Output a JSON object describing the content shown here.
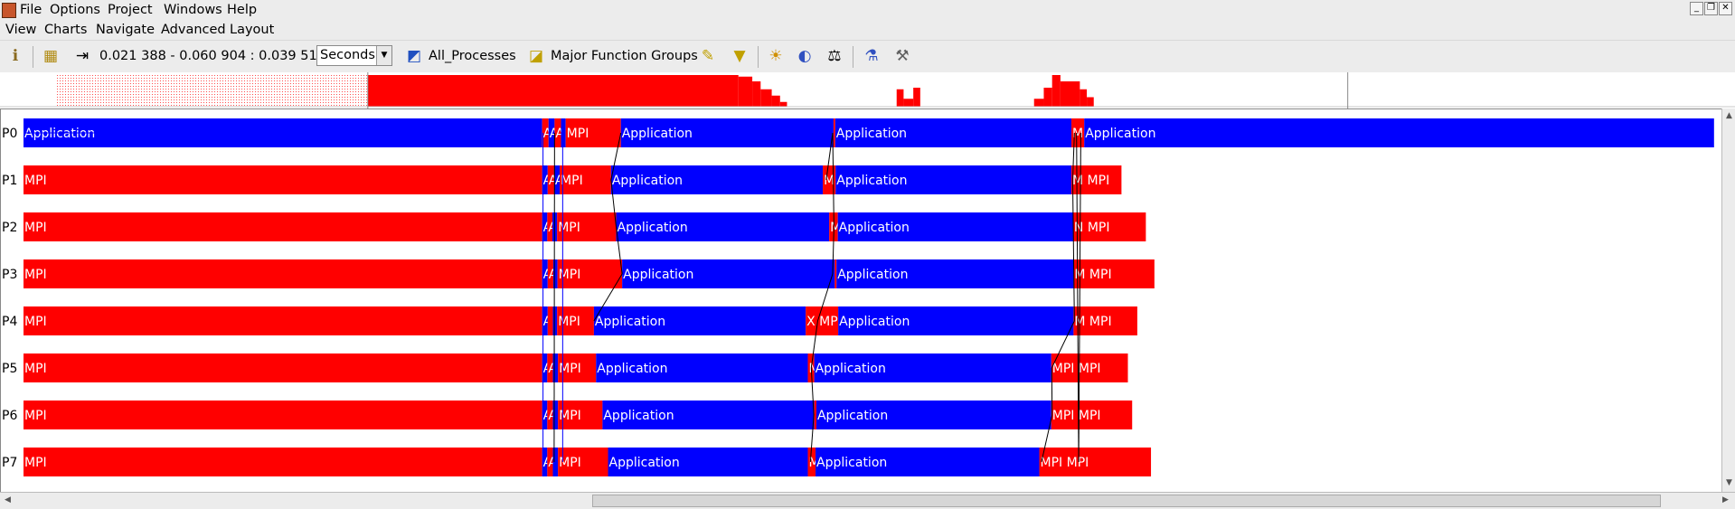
{
  "menubar": {
    "items": [
      "File",
      "Options",
      "Project",
      "Windows",
      "Help"
    ]
  },
  "submenu": {
    "items": [
      "View",
      "Charts",
      "Navigate",
      "Advanced",
      "Layout"
    ]
  },
  "window_controls": [
    "minimize",
    "restore",
    "close"
  ],
  "toolbar": {
    "time_range": "0.021 388 - 0.060 904 : 0.039 516",
    "unit": "Seconds",
    "process_filter": "All_Processes",
    "function_group": "Major Function Groups",
    "icons": [
      "info-icon",
      "timeline-icon",
      "zoom-range-icon",
      "process-filter-icon",
      "function-group-icon",
      "highlight-icon",
      "filter-icon",
      "sun-icon",
      "contrast-icon",
      "balance-icon",
      "wand-icon",
      "tools-icon"
    ]
  },
  "colors": {
    "mpi": "#ff0000",
    "application": "#0000ff",
    "message_line": "#000000"
  },
  "legend_labels": {
    "mpi": "MPI",
    "application": "Application"
  },
  "processes": [
    {
      "label": "P0",
      "segments": [
        {
          "s": 0.021388,
          "e": 0.03351,
          "t": "application",
          "txt": "Application"
        },
        {
          "s": 0.03351,
          "e": 0.03366,
          "t": "mpi",
          "txt": "A"
        },
        {
          "s": 0.03366,
          "e": 0.0338,
          "t": "application",
          "txt": "A"
        },
        {
          "s": 0.0338,
          "e": 0.03395,
          "t": "mpi",
          "txt": "A"
        },
        {
          "s": 0.03395,
          "e": 0.03406,
          "t": "application",
          "txt": ""
        },
        {
          "s": 0.03406,
          "e": 0.03535,
          "t": "mpi",
          "txt": "MPI"
        },
        {
          "s": 0.03535,
          "e": 0.04032,
          "t": "application",
          "txt": "Application"
        },
        {
          "s": 0.04032,
          "e": 0.04036,
          "t": "mpi",
          "txt": ""
        },
        {
          "s": 0.04036,
          "e": 0.04588,
          "t": "application",
          "txt": "Application"
        },
        {
          "s": 0.04588,
          "e": 0.04618,
          "t": "mpi",
          "txt": "MI"
        },
        {
          "s": 0.04618,
          "e": 0.0609,
          "t": "application",
          "txt": "Application"
        }
      ]
    },
    {
      "label": "P1",
      "segments": [
        {
          "s": 0.021388,
          "e": 0.03351,
          "t": "mpi",
          "txt": "MPI"
        },
        {
          "s": 0.03351,
          "e": 0.03364,
          "t": "application",
          "txt": "A"
        },
        {
          "s": 0.03364,
          "e": 0.03379,
          "t": "mpi",
          "txt": "A"
        },
        {
          "s": 0.03379,
          "e": 0.03392,
          "t": "application",
          "txt": "A"
        },
        {
          "s": 0.03392,
          "e": 0.03512,
          "t": "mpi",
          "txt": "MPI"
        },
        {
          "s": 0.03512,
          "e": 0.04007,
          "t": "application",
          "txt": "Application"
        },
        {
          "s": 0.04007,
          "e": 0.04037,
          "t": "mpi",
          "txt": "M"
        },
        {
          "s": 0.04037,
          "e": 0.04588,
          "t": "application",
          "txt": "Application"
        },
        {
          "s": 0.04588,
          "e": 0.04705,
          "t": "mpi",
          "txt": "M MPI"
        }
      ]
    },
    {
      "label": "P2",
      "segments": [
        {
          "s": 0.021388,
          "e": 0.03351,
          "t": "mpi",
          "txt": "MPI"
        },
        {
          "s": 0.03351,
          "e": 0.03363,
          "t": "application",
          "txt": "A"
        },
        {
          "s": 0.03363,
          "e": 0.03375,
          "t": "mpi",
          "txt": "A"
        },
        {
          "s": 0.03375,
          "e": 0.03386,
          "t": "application",
          "txt": ""
        },
        {
          "s": 0.03386,
          "e": 0.03524,
          "t": "mpi",
          "txt": "MPI"
        },
        {
          "s": 0.03524,
          "e": 0.04022,
          "t": "application",
          "txt": "Application"
        },
        {
          "s": 0.04022,
          "e": 0.04042,
          "t": "mpi",
          "txt": "M"
        },
        {
          "s": 0.04042,
          "e": 0.04592,
          "t": "application",
          "txt": "Application"
        },
        {
          "s": 0.04592,
          "e": 0.04762,
          "t": "mpi",
          "txt": "N MPI"
        }
      ]
    },
    {
      "label": "P3",
      "segments": [
        {
          "s": 0.021388,
          "e": 0.03351,
          "t": "mpi",
          "txt": "MPI"
        },
        {
          "s": 0.03351,
          "e": 0.03364,
          "t": "application",
          "txt": "A"
        },
        {
          "s": 0.03364,
          "e": 0.03377,
          "t": "mpi",
          "txt": "A"
        },
        {
          "s": 0.03377,
          "e": 0.03387,
          "t": "application",
          "txt": ""
        },
        {
          "s": 0.03387,
          "e": 0.03538,
          "t": "mpi",
          "txt": "MPI"
        },
        {
          "s": 0.03538,
          "e": 0.04035,
          "t": "application",
          "txt": "Application"
        },
        {
          "s": 0.04035,
          "e": 0.04039,
          "t": "mpi",
          "txt": ""
        },
        {
          "s": 0.04039,
          "e": 0.04593,
          "t": "application",
          "txt": "Application"
        },
        {
          "s": 0.04593,
          "e": 0.04782,
          "t": "mpi",
          "txt": "M MPI"
        }
      ]
    },
    {
      "label": "P4",
      "segments": [
        {
          "s": 0.021388,
          "e": 0.03351,
          "t": "mpi",
          "txt": "MPI"
        },
        {
          "s": 0.03351,
          "e": 0.03364,
          "t": "application",
          "txt": "A"
        },
        {
          "s": 0.03364,
          "e": 0.03376,
          "t": "mpi",
          "txt": ""
        },
        {
          "s": 0.03376,
          "e": 0.03386,
          "t": "application",
          "txt": ""
        },
        {
          "s": 0.03386,
          "e": 0.03472,
          "t": "mpi",
          "txt": "MPI"
        },
        {
          "s": 0.03472,
          "e": 0.03967,
          "t": "application",
          "txt": "Application"
        },
        {
          "s": 0.03967,
          "e": 0.04043,
          "t": "mpi",
          "txt": "X MPI"
        },
        {
          "s": 0.04043,
          "e": 0.04593,
          "t": "application",
          "txt": "Application"
        },
        {
          "s": 0.04593,
          "e": 0.04742,
          "t": "mpi",
          "txt": "M MPI"
        }
      ]
    },
    {
      "label": "P5",
      "segments": [
        {
          "s": 0.021388,
          "e": 0.03351,
          "t": "mpi",
          "txt": "MPI"
        },
        {
          "s": 0.03351,
          "e": 0.03363,
          "t": "application",
          "txt": "A"
        },
        {
          "s": 0.03363,
          "e": 0.03376,
          "t": "mpi",
          "txt": "A"
        },
        {
          "s": 0.03376,
          "e": 0.03388,
          "t": "application",
          "txt": ""
        },
        {
          "s": 0.03388,
          "e": 0.03477,
          "t": "mpi",
          "txt": "MPI"
        },
        {
          "s": 0.03477,
          "e": 0.03972,
          "t": "application",
          "txt": "Application"
        },
        {
          "s": 0.03972,
          "e": 0.03987,
          "t": "mpi",
          "txt": "M"
        },
        {
          "s": 0.03987,
          "e": 0.04541,
          "t": "application",
          "txt": "Application"
        },
        {
          "s": 0.04541,
          "e": 0.0472,
          "t": "mpi",
          "txt": "MPI MPI"
        }
      ]
    },
    {
      "label": "P6",
      "segments": [
        {
          "s": 0.021388,
          "e": 0.03351,
          "t": "mpi",
          "txt": "MPI"
        },
        {
          "s": 0.03351,
          "e": 0.03363,
          "t": "application",
          "txt": "A"
        },
        {
          "s": 0.03363,
          "e": 0.03376,
          "t": "mpi",
          "txt": "A"
        },
        {
          "s": 0.03376,
          "e": 0.03388,
          "t": "application",
          "txt": ""
        },
        {
          "s": 0.03388,
          "e": 0.03492,
          "t": "mpi",
          "txt": "MPI"
        },
        {
          "s": 0.03492,
          "e": 0.03987,
          "t": "application",
          "txt": "Application"
        },
        {
          "s": 0.03987,
          "e": 0.03992,
          "t": "mpi",
          "txt": ""
        },
        {
          "s": 0.03992,
          "e": 0.04541,
          "t": "application",
          "txt": "Application"
        },
        {
          "s": 0.04541,
          "e": 0.0473,
          "t": "mpi",
          "txt": "MPI MPI"
        }
      ]
    },
    {
      "label": "P7",
      "segments": [
        {
          "s": 0.021388,
          "e": 0.03351,
          "t": "mpi",
          "txt": "MPI"
        },
        {
          "s": 0.03351,
          "e": 0.03363,
          "t": "application",
          "txt": "A"
        },
        {
          "s": 0.03363,
          "e": 0.03376,
          "t": "mpi",
          "txt": "A"
        },
        {
          "s": 0.03376,
          "e": 0.03388,
          "t": "application",
          "txt": ""
        },
        {
          "s": 0.03388,
          "e": 0.03505,
          "t": "mpi",
          "txt": "MPI"
        },
        {
          "s": 0.03505,
          "e": 0.03972,
          "t": "application",
          "txt": "Application"
        },
        {
          "s": 0.03972,
          "e": 0.0399,
          "t": "mpi",
          "txt": "M"
        },
        {
          "s": 0.0399,
          "e": 0.04513,
          "t": "application",
          "txt": "Application"
        },
        {
          "s": 0.04513,
          "e": 0.04774,
          "t": "mpi",
          "txt": "MPI MPI"
        }
      ]
    }
  ],
  "messages": [
    {
      "from": 0,
      "ts": 0.021388,
      "to": 0,
      "te": 0.02963
    },
    {
      "from": 0,
      "ts": 0.0403,
      "to": 1,
      "te": 0.04015
    },
    {
      "from": 0,
      "ts": 0.0403,
      "to": 2,
      "te": 0.04033
    },
    {
      "from": 2,
      "ts": 0.04033,
      "to": 3,
      "te": 0.0403
    },
    {
      "from": 3,
      "ts": 0.0403,
      "to": 4,
      "te": 0.03995
    },
    {
      "from": 4,
      "ts": 0.03995,
      "to": 5,
      "te": 0.0398
    },
    {
      "from": 5,
      "ts": 0.0398,
      "to": 6,
      "te": 0.03986
    },
    {
      "from": 6,
      "ts": 0.03986,
      "to": 7,
      "te": 0.03978
    },
    {
      "from": 0,
      "ts": 0.03535,
      "to": 1,
      "te": 0.03512
    },
    {
      "from": 1,
      "ts": 0.03512,
      "to": 2,
      "te": 0.03524
    },
    {
      "from": 2,
      "ts": 0.03524,
      "to": 3,
      "te": 0.03538
    },
    {
      "from": 3,
      "ts": 0.03538,
      "to": 4,
      "te": 0.03472
    },
    {
      "from": 0,
      "ts": 0.04595,
      "to": 1,
      "te": 0.04591
    },
    {
      "from": 1,
      "ts": 0.04591,
      "to": 4,
      "te": 0.04595
    },
    {
      "from": 4,
      "ts": 0.04595,
      "to": 5,
      "te": 0.04542
    },
    {
      "from": 5,
      "ts": 0.04542,
      "to": 6,
      "te": 0.04543
    },
    {
      "from": 6,
      "ts": 0.04543,
      "to": 7,
      "te": 0.04518
    },
    {
      "from": 0,
      "ts": 0.0461,
      "to": 7,
      "te": 0.04605
    },
    {
      "from": 7,
      "ts": 0.04605,
      "to": 0,
      "te": 0.046
    },
    {
      "from": 0,
      "ts": 0.03353,
      "to": 7,
      "te": 0.03353
    },
    {
      "from": 0,
      "ts": 0.0338,
      "to": 7,
      "te": 0.03379
    },
    {
      "from": 0,
      "ts": 0.03399,
      "to": 7,
      "te": 0.03399
    }
  ],
  "overview": {
    "t_start": 0.0,
    "t_end": 0.125,
    "dotted_region": [
      0.004,
      0.0265
    ],
    "window_marks": [
      0.0265,
      0.0971
    ],
    "blocks": [
      {
        "s": 0.0265,
        "e": 0.0532,
        "h": 1.0
      },
      {
        "s": 0.0532,
        "e": 0.0542,
        "h": 0.95
      },
      {
        "s": 0.0542,
        "e": 0.0548,
        "h": 0.8
      },
      {
        "s": 0.0548,
        "e": 0.0556,
        "h": 0.55
      },
      {
        "s": 0.0556,
        "e": 0.0562,
        "h": 0.35
      },
      {
        "s": 0.0562,
        "e": 0.0567,
        "h": 0.15
      },
      {
        "s": 0.0646,
        "e": 0.0651,
        "h": 0.55
      },
      {
        "s": 0.0651,
        "e": 0.0658,
        "h": 0.25
      },
      {
        "s": 0.0658,
        "e": 0.0663,
        "h": 0.6
      },
      {
        "s": 0.0745,
        "e": 0.0752,
        "h": 0.25
      },
      {
        "s": 0.0752,
        "e": 0.0758,
        "h": 0.6
      },
      {
        "s": 0.0758,
        "e": 0.0764,
        "h": 1.0
      },
      {
        "s": 0.0764,
        "e": 0.0778,
        "h": 0.8
      },
      {
        "s": 0.0778,
        "e": 0.0783,
        "h": 0.55
      },
      {
        "s": 0.0783,
        "e": 0.0788,
        "h": 0.3
      }
    ]
  }
}
